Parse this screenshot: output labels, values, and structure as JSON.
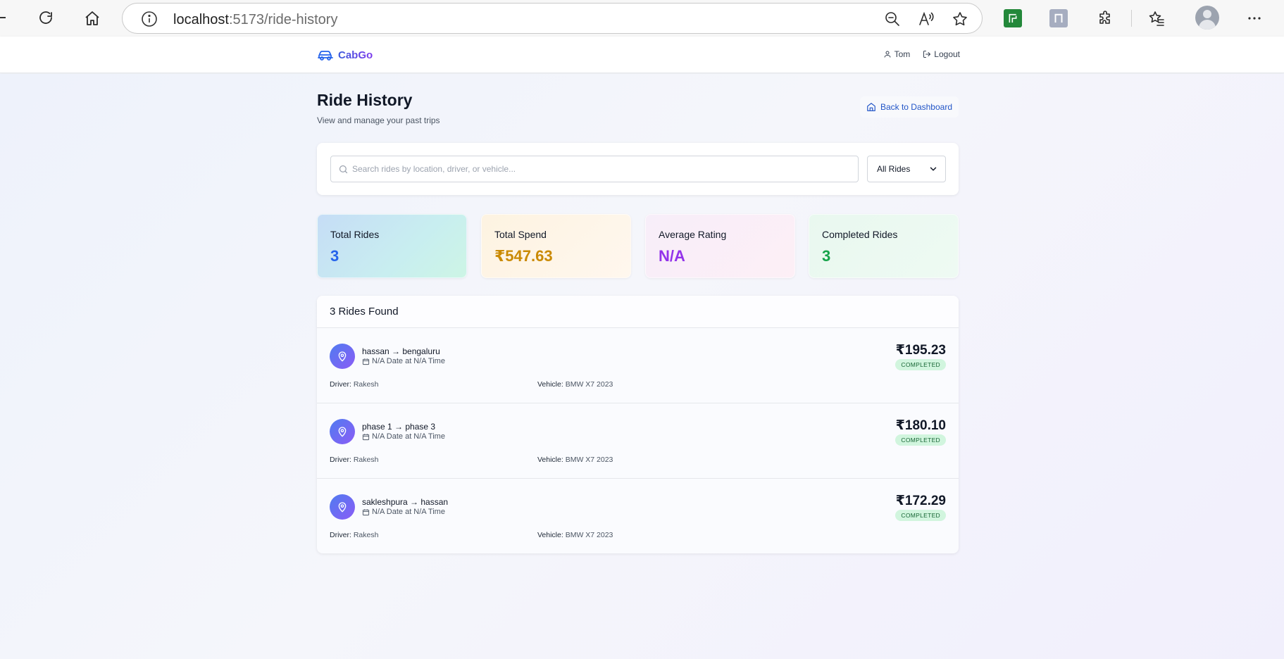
{
  "browser": {
    "url_host": "localhost",
    "url_path": ":5173/ride-history"
  },
  "header": {
    "brand": "CabGo",
    "user": "Tom",
    "logout": "Logout"
  },
  "page": {
    "title": "Ride History",
    "subtitle": "View and manage your past trips",
    "back_label": "Back to Dashboard"
  },
  "search": {
    "placeholder": "Search rides by location, driver, or vehicle...",
    "filter_value": "All Rides"
  },
  "stats": [
    {
      "label": "Total Rides",
      "value": "3",
      "color": "#2563eb"
    },
    {
      "label": "Total Spend",
      "value": "₹547.63",
      "color": "#ca8a04"
    },
    {
      "label": "Average Rating",
      "value": "N/A",
      "color": "#9333ea"
    },
    {
      "label": "Completed Rides",
      "value": "3",
      "color": "#16a34a"
    }
  ],
  "rides": {
    "count_label": "3 Rides Found",
    "items": [
      {
        "route": "hassan → bengaluru",
        "when": "N/A Date at N/A Time",
        "driver_label": "Driver:",
        "driver": "Rakesh",
        "vehicle_label": "Vehicle:",
        "vehicle": "BMW X7 2023",
        "price": "₹195.23",
        "status": "COMPLETED"
      },
      {
        "route": "phase 1 → phase 3",
        "when": "N/A Date at N/A Time",
        "driver_label": "Driver:",
        "driver": "Rakesh",
        "vehicle_label": "Vehicle:",
        "vehicle": "BMW X7 2023",
        "price": "₹180.10",
        "status": "COMPLETED"
      },
      {
        "route": "sakleshpura → hassan",
        "when": "N/A Date at N/A Time",
        "driver_label": "Driver:",
        "driver": "Rakesh",
        "vehicle_label": "Vehicle:",
        "vehicle": "BMW X7 2023",
        "price": "₹172.29",
        "status": "COMPLETED"
      }
    ]
  },
  "icons": {
    "brand": "car-icon",
    "user": "user-icon",
    "logout": "logout-icon",
    "back": "home-icon",
    "search": "search-icon",
    "filter": "chevron-down-icon",
    "ride": "map-pin-icon",
    "when": "calendar-icon"
  }
}
